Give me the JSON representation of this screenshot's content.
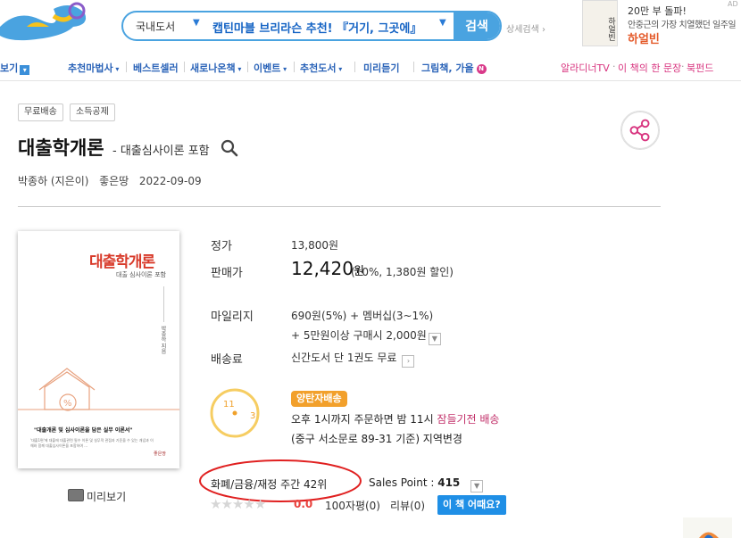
{
  "header": {
    "search_scope": "국내도서",
    "search_value": "캡틴마블 브리라슨 추천! 『거기, 그곳에』",
    "search_button": "검색",
    "detail_search": "상세검색",
    "ad": {
      "book_text": "하얼빈",
      "line1": "20만 부 돌파!",
      "line2": "안중근의 가장 치열했던 일주일",
      "line3": "하얼빈",
      "badge": "AD"
    }
  },
  "nav": {
    "items": [
      "보기",
      "추천마법사",
      "베스트셀러",
      "새로나온책",
      "이벤트",
      "추천도서",
      "미리듣기",
      "그림책, 가을"
    ],
    "new_badge": "N",
    "right_links": [
      "알라디너TV",
      "이 책의 한 문장",
      "북펀드"
    ]
  },
  "tags": [
    "무료배송",
    "소득공제"
  ],
  "book": {
    "title": "대출학개론",
    "subtitle": "- 대출심사이론 포함",
    "author": "박종하 (지은이)",
    "publisher": "좋은땅",
    "date": "2022-09-09",
    "cover": {
      "title": "대출학개론",
      "sub": "대출 심사이론 포함",
      "author": "박종하 지음",
      "caption": "\"대출개론 및 심사이론을 담은 실무 이론서\"",
      "small": "'대출1편'에 대출에 대출관련 필수 이론 및 실무적 관점과 기준을 수 있는 개념과 이해와 함께 대출심사이론을 포함하여 ...",
      "publisher_mark": "좋은땅"
    },
    "preview_label": "미리보기"
  },
  "price": {
    "list_label": "정가",
    "list_value": "13,800원",
    "sale_label": "판매가",
    "sale_value": "12,420",
    "sale_unit": "원",
    "sale_note": "(10%, 1,380원 할인)",
    "mileage_label": "마일리지",
    "mileage_value": "690원(5%) + 멤버십(3~1%)",
    "mileage_extra": "+ 5만원이상 구매시 2,000원",
    "shipping_label": "배송료",
    "shipping_value": "신간도서 단 1권도 무료"
  },
  "delivery": {
    "clock_hours": [
      "11",
      "3"
    ],
    "badge": "양탄자배송",
    "line1_prefix": "오후 1시까지 주문하면 밤 11시 ",
    "line1_highlight": "잠들기전 배송",
    "line2": "(중구 서소문로 89-31 기준) 지역변경"
  },
  "stats": {
    "ranking": "화폐/금융/재정 주간 42위",
    "sales_point_label": "Sales Point : ",
    "sales_point_value": "415",
    "stars_total": 5,
    "rating": "0.0",
    "review_100": "100자평(0)",
    "review": "리뷰(0)",
    "how_button": "이 책 어때요?"
  },
  "colors": {
    "brand_blue": "#4aa3e0",
    "nav_blue": "#2a63b8",
    "accent_pink": "#d8347f",
    "rating_red": "#e9433e"
  }
}
